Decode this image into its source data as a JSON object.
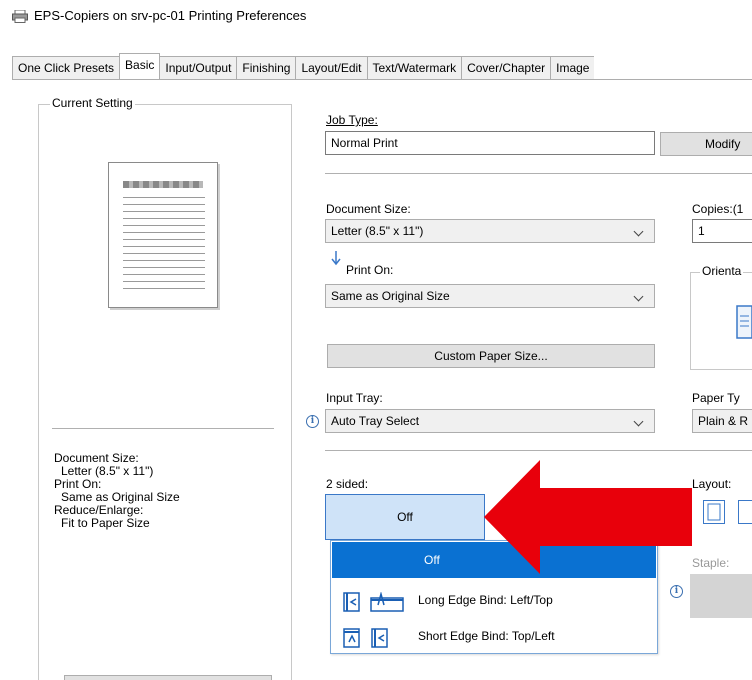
{
  "window": {
    "title": "EPS-Copiers on srv-pc-01 Printing Preferences"
  },
  "tabs": [
    {
      "label": "One Click Presets",
      "active": false
    },
    {
      "label": "Basic",
      "active": true
    },
    {
      "label": "Input/Output",
      "active": false
    },
    {
      "label": "Finishing",
      "active": false
    },
    {
      "label": "Layout/Edit",
      "active": false
    },
    {
      "label": "Text/Watermark",
      "active": false
    },
    {
      "label": "Cover/Chapter",
      "active": false
    },
    {
      "label": "Image",
      "active": false
    }
  ],
  "current_setting": {
    "group_label": "Current Setting",
    "summary": [
      {
        "label": "Document Size:",
        "value": "Letter (8.5\" x 11\")"
      },
      {
        "label": "Print On:",
        "value": "Same as Original Size"
      },
      {
        "label": "Reduce/Enlarge:",
        "value": "Fit to Paper Size"
      }
    ]
  },
  "job_type": {
    "label": "Job Type:",
    "value": "Normal Print",
    "modify_label": "Modify"
  },
  "document_size": {
    "label": "Document Size:",
    "value": "Letter (8.5\" x 11\")"
  },
  "copies": {
    "label": "Copies:(1",
    "value": "1"
  },
  "print_on": {
    "label": "Print On:",
    "value": "Same as Original Size"
  },
  "orientation": {
    "label": "Orienta"
  },
  "custom_paper_size": {
    "label": "Custom Paper Size..."
  },
  "input_tray": {
    "label": "Input Tray:",
    "value": "Auto Tray Select"
  },
  "paper_type": {
    "label": "Paper Ty",
    "value": "Plain & R"
  },
  "two_sided": {
    "label": "2 sided:",
    "value": "Off",
    "options": [
      {
        "label": "Off",
        "selected": true
      },
      {
        "label": "Long Edge Bind: Left/Top",
        "selected": false
      },
      {
        "label": "Short Edge Bind: Top/Left",
        "selected": false
      }
    ]
  },
  "layout": {
    "label": "Layout:"
  },
  "staple": {
    "label": "Staple:"
  },
  "colors": {
    "arrow": "#e8000b",
    "selected_option": "#0a71d2",
    "dropdown_active": "#cfe3f8"
  }
}
